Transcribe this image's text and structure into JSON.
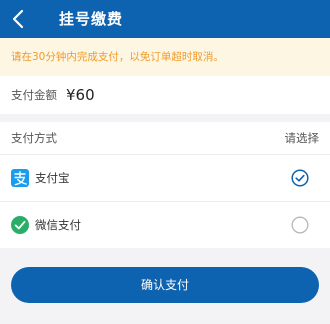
{
  "header": {
    "title": "挂号缴费",
    "back_icon": "chevron-left-icon",
    "background_color": "#0e63b0"
  },
  "notice": {
    "text": "请在30分钟内完成支付，以免订单超时取消。",
    "color": "#f19a2a",
    "background_color": "#fcf6e3"
  },
  "payment": {
    "amount_label": "支付金额",
    "amount_value": "¥60"
  },
  "methods": {
    "title": "支付方式",
    "hint": "请选择",
    "items": [
      {
        "label": "支付宝",
        "icon": "alipay-icon",
        "selected": true,
        "icon_color": "#1a9ded"
      },
      {
        "label": "微信支付",
        "icon": "wechat-pay-icon",
        "selected": false,
        "icon_color": "#2aae67"
      }
    ]
  },
  "confirm": {
    "label": "确认支付",
    "color": "#0e63b0"
  }
}
